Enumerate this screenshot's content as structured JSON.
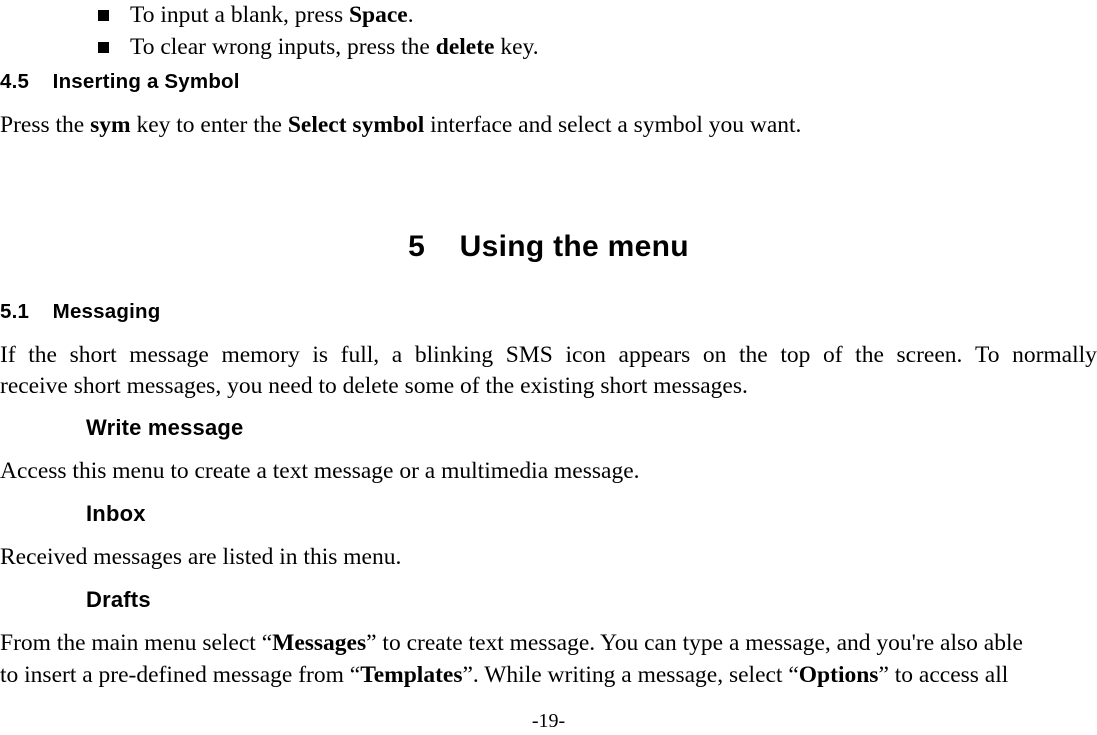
{
  "document": {
    "page_number_label": "-19-"
  },
  "bullets": [
    {
      "text_before": "To input a blank, press ",
      "bold": "Space",
      "text_after": "."
    },
    {
      "text_before": "To clear wrong inputs, press the ",
      "bold": "delete",
      "text_after": " key."
    }
  ],
  "section_4_5": {
    "number": "4.5",
    "title": "Inserting a Symbol",
    "heading_full": "4.5    Inserting a Symbol",
    "paragraph": {
      "part1": "Press the ",
      "bold1": "sym",
      "part2": " key to enter the ",
      "bold2": "Select symbol",
      "part3": " interface and select a symbol you want."
    }
  },
  "chapter_5": {
    "number": "5",
    "title": "Using the menu",
    "heading_full": "5    Using the menu"
  },
  "section_5_1": {
    "number": "5.1",
    "title": "Messaging",
    "heading_full": "5.1    Messaging",
    "paragraph_line1_words": [
      "If",
      "the",
      "short",
      "message",
      "memory",
      "is",
      "full,",
      "a",
      "blinking",
      "SMS",
      "icon",
      "appears",
      "on",
      "the",
      "top",
      "of",
      "the",
      "screen.",
      "To",
      "normally"
    ],
    "paragraph_line2": "receive short messages, you need to delete some of the existing short messages."
  },
  "subsections": {
    "write_message": {
      "title": "Write message",
      "body": "Access this menu to create a text message or a multimedia message."
    },
    "inbox": {
      "title": "Inbox",
      "body": "Received messages are listed in this menu."
    },
    "drafts": {
      "title": "Drafts",
      "body_line1": {
        "part1": "From the main menu select “",
        "bold1": "Messages",
        "part2": "” to create text message. You can type a message, and you're also able"
      },
      "body_line2": {
        "part1": "to insert a pre-defined message from “",
        "bold1": "Templates",
        "part2": "”. While writing a message, select “",
        "bold2": "Options",
        "part3": "” to access all"
      }
    }
  }
}
